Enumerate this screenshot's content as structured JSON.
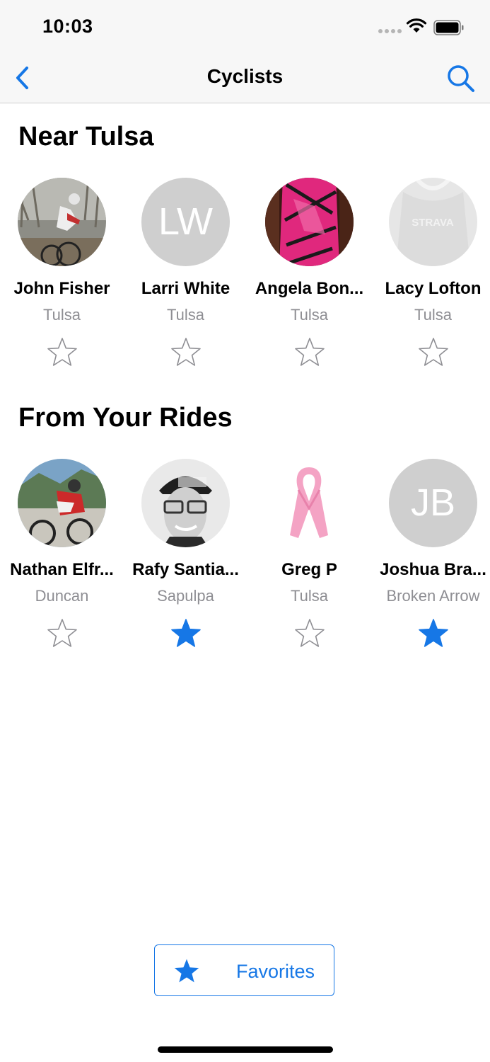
{
  "status_bar": {
    "time": "10:03"
  },
  "nav": {
    "title": "Cyclists",
    "back_icon": "chevron-left-icon",
    "search_icon": "search-icon"
  },
  "colors": {
    "accent": "#1677e6",
    "secondary_text": "#8e8e93",
    "placeholder_avatar": "#cfcfcf"
  },
  "sections": [
    {
      "title": "Near Tulsa",
      "cyclists": [
        {
          "name": "John Fisher",
          "city": "Tulsa",
          "avatar": "photo",
          "favorite": false
        },
        {
          "name": "Larri White",
          "city": "Tulsa",
          "avatar": "initials",
          "initials": "LW",
          "favorite": false
        },
        {
          "name": "Angela Bon...",
          "city": "Tulsa",
          "avatar": "photo",
          "favorite": false
        },
        {
          "name": "Lacy Lofton",
          "city": "Tulsa",
          "avatar": "default-logo",
          "logo_text": "STRAVA",
          "favorite": false
        }
      ]
    },
    {
      "title": "From Your Rides",
      "cyclists": [
        {
          "name": "Nathan Elfr...",
          "city": "Duncan",
          "avatar": "photo",
          "favorite": false
        },
        {
          "name": "Rafy Santia...",
          "city": "Sapulpa",
          "avatar": "photo",
          "favorite": true
        },
        {
          "name": "Greg P",
          "city": "Tulsa",
          "avatar": "ribbon",
          "favorite": false
        },
        {
          "name": "Joshua Bra...",
          "city": "Broken Arrow",
          "avatar": "initials",
          "initials": "JB",
          "favorite": true
        }
      ]
    }
  ],
  "favorites_button": {
    "label": "Favorites",
    "icon": "star-filled-icon"
  }
}
